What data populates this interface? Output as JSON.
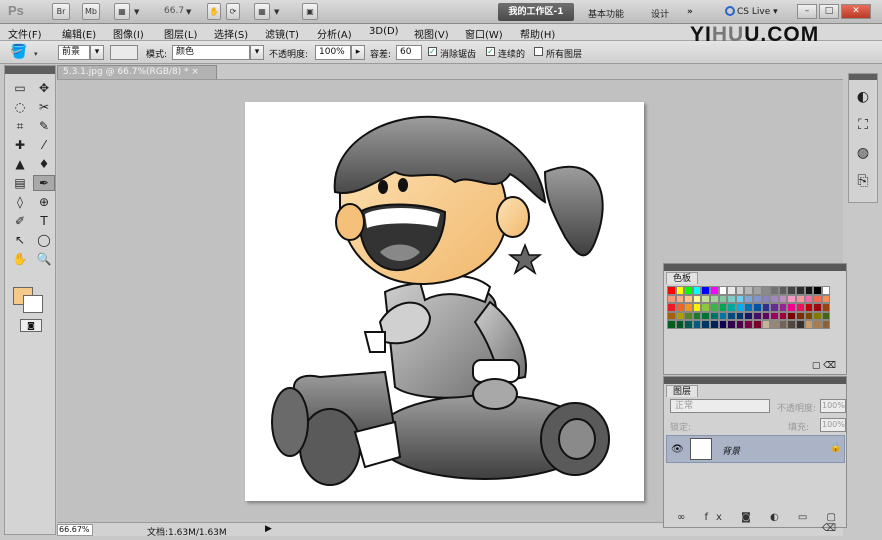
{
  "app_bar": {
    "logo": "Ps",
    "btn_br": "Br",
    "btn_mb": "Mb",
    "zoom": "66.7",
    "workspace_active": "我的工作区-1",
    "workspace_basic": "基本功能",
    "workspace_design": "设计",
    "more": "»",
    "cs_live": "CS Live",
    "window_controls": [
      "–",
      "□",
      "✕"
    ]
  },
  "menu": {
    "items": [
      "文件(F)",
      "编辑(E)",
      "图像(I)",
      "图层(L)",
      "选择(S)",
      "滤镜(T)",
      "分析(A)",
      "3D(D)",
      "视图(V)",
      "窗口(W)",
      "帮助(H)"
    ]
  },
  "watermark": {
    "part1": "YI",
    "part2": "HU",
    "part3": "U.COM"
  },
  "options": {
    "fill_source": "前景",
    "mode_label": "模式:",
    "mode_value": "颜色",
    "opacity_label": "不透明度:",
    "opacity_value": "100%",
    "tolerance_label": "容差:",
    "tolerance_value": "60",
    "antialias_label": "消除锯齿",
    "contiguous_label": "连续的",
    "all_layers_label": "所有图层"
  },
  "tools": {
    "icons": [
      "▭",
      "✥",
      "◌",
      "✂",
      "⌗",
      "✎",
      "✚",
      "⁄",
      "▲",
      "♦",
      "▤",
      "✒",
      "◊",
      "⊕",
      "✐",
      "T",
      "↖",
      "◯",
      "✋",
      "🔍"
    ]
  },
  "document": {
    "tab_title": "5.3.1.jpg @ 66.7%(RGB/8) *",
    "tab_close": "×"
  },
  "status": {
    "zoom": "66.67%",
    "doc_info": "文档:1.63M/1.63M"
  },
  "swatches": {
    "title": "色板",
    "colors": [
      "#ff0000",
      "#ffff00",
      "#00ff00",
      "#00ffff",
      "#0000ff",
      "#ff00ff",
      "#ffffff",
      "#e8e8e8",
      "#d1d1d1",
      "#b9b9b9",
      "#a2a2a2",
      "#8b8b8b",
      "#737373",
      "#5c5c5c",
      "#454545",
      "#2e2e2e",
      "#161616",
      "#000000",
      "#ffffff",
      "#f7977a",
      "#f9ad81",
      "#fdc68a",
      "#fff79a",
      "#c4df9b",
      "#a2d39c",
      "#82ca9d",
      "#7bcdc8",
      "#6ecff6",
      "#7ea7d8",
      "#8493ca",
      "#8882be",
      "#a187be",
      "#bc8dbf",
      "#f49ac2",
      "#f6989d",
      "#f06eaa",
      "#f26c4f",
      "#f68e55",
      "#ed1c24",
      "#f26522",
      "#f7941d",
      "#fff200",
      "#8dc63f",
      "#39b54a",
      "#00a651",
      "#00a99d",
      "#00aeef",
      "#0072bc",
      "#0054a6",
      "#2e3192",
      "#662d91",
      "#92278f",
      "#ec008c",
      "#ed145b",
      "#c2000b",
      "#9e0b0f",
      "#a0410d",
      "#a36209",
      "#aba000",
      "#598527",
      "#1a7b30",
      "#007236",
      "#00746b",
      "#0076a3",
      "#004b80",
      "#003471",
      "#1b1464",
      "#440e62",
      "#630460",
      "#9e005d",
      "#9e0039",
      "#790000",
      "#7b2e00",
      "#7d4900",
      "#827b00",
      "#406618",
      "#005e20",
      "#005826",
      "#005952",
      "#005b7f",
      "#003663",
      "#002157",
      "#0d004c",
      "#32004b",
      "#4b0049",
      "#7b0046",
      "#7a0026",
      "#c7b299",
      "#998675",
      "#736357",
      "#534741",
      "#37302d",
      "#c69c6d",
      "#a67c52",
      "#8c6239"
    ],
    "footer": "▢ ⌫"
  },
  "layers": {
    "title": "图层",
    "blend_mode": "正常",
    "opacity_label": "不透明度:",
    "opacity_value": "100%",
    "lock_label": "锁定:",
    "fill_label": "填充:",
    "fill_value": "100%",
    "layer_name": "背景",
    "footer_icons": "∞ fx ◙ ◐ ▭ ▢ ⌫"
  }
}
